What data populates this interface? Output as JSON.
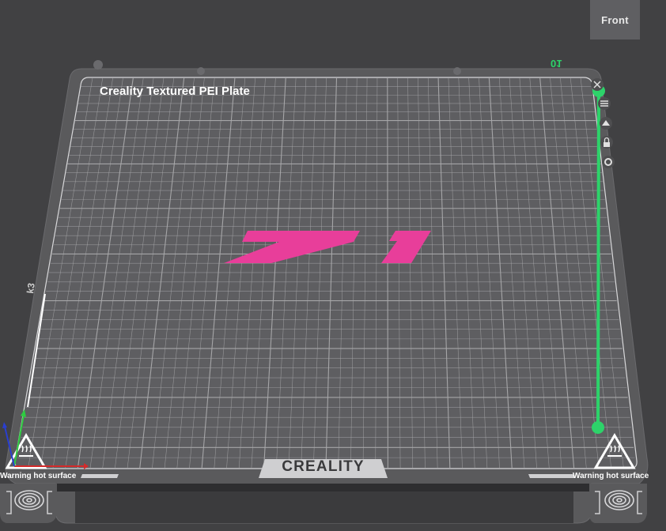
{
  "view_button": {
    "label": "Front"
  },
  "plate": {
    "title": "Creality Textured PEI Plate",
    "brand": "CREALITY",
    "number": "01",
    "warning_left": "Warning hot surface",
    "warning_right": "Warning hot surface"
  },
  "model": {
    "text": "71",
    "color": "#e83e9a"
  },
  "colors": {
    "background": "#414143",
    "plate": "#5a5a5c",
    "grid": "#a9a9ab",
    "accent_green": "#2dd36a",
    "axis_red": "#d42b2b",
    "axis_green": "#2ecc40",
    "axis_blue": "#2a3fcf"
  },
  "plate_tools": [
    {
      "name": "close-icon"
    },
    {
      "name": "arrange-icon"
    },
    {
      "name": "slice-icon"
    },
    {
      "name": "lock-icon"
    },
    {
      "name": "settings-icon"
    }
  ]
}
